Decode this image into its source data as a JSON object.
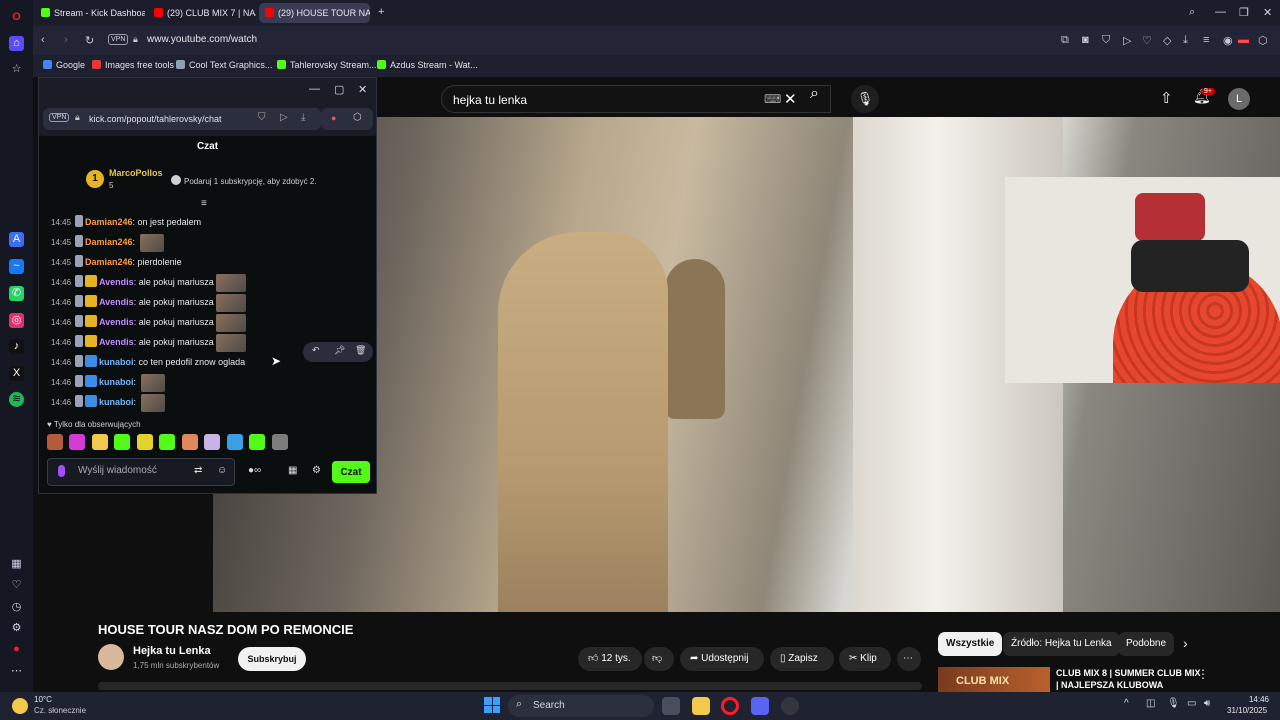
{
  "browser": {
    "tabs": [
      {
        "title": "Stream - Kick Dashboard",
        "color": "#53fc18"
      },
      {
        "title": "(29) CLUB MIX 7 | NAJLEP",
        "color": "#ff0000"
      },
      {
        "title": "(29) HOUSE TOUR NA",
        "color": "#ff0000"
      }
    ],
    "url": "www.youtube.com/watch",
    "vpn": "VPN",
    "bookmarks": [
      {
        "label": "Google",
        "color": "#4285f4"
      },
      {
        "label": "Images free tools",
        "color": "#e53935"
      },
      {
        "label": "Cool Text Graphics...",
        "color": "#8fa1b3"
      },
      {
        "label": "Tahlerovsky Stream...",
        "color": "#53fc18"
      },
      {
        "label": "Azdus Stream - Wat...",
        "color": "#53fc18"
      }
    ]
  },
  "youtube": {
    "search_value": "hejka tu lenka",
    "video_title": "HOUSE TOUR NASZ DOM PO REMONCIE",
    "channel_name": "Hejka tu Lenka",
    "channel_subs": "1,75 mln subskrybentów",
    "subscribe_label": "Subskrybuj",
    "likes": "12 tys.",
    "share_label": "Udostępnij",
    "save_label": "Zapisz",
    "clip_label": "Klip",
    "notif_count": "9+",
    "avatar_letter": "L",
    "chips": [
      "Wszystkie",
      "Źródło: Hejka tu Lenka",
      "Podobne"
    ],
    "rec_title": "CLUB MIX 8 | SUMMER CLUB MIX | NAJLEPSZA KLUBOWA",
    "rec_thumb_text": "CLUB MIX"
  },
  "kick": {
    "url": "kick.com/popout/tahlerovsky/chat",
    "vpn": "VPN",
    "header": "Czat",
    "pinned": {
      "rank": "1",
      "user": "MarcoPollos",
      "level": "5",
      "text": "Podaruj 1 subskrypcję, aby zdobyć 2."
    },
    "messages": [
      {
        "time": "14:45",
        "user": "Damian246",
        "color": "#ff9a3c",
        "text": "on jest pedalem",
        "emote": false,
        "badge": false
      },
      {
        "time": "14:45",
        "user": "Damian246",
        "color": "#ff9a3c",
        "text": "",
        "emote": true,
        "badge": false
      },
      {
        "time": "14:45",
        "user": "Damian246",
        "color": "#ff9a3c",
        "text": "pierdolenie",
        "emote": false,
        "badge": false
      },
      {
        "time": "14:46",
        "user": "Avendis",
        "color": "#c38cff",
        "text": "ale pokuj mariusza",
        "emote": true,
        "badge": true
      },
      {
        "time": "14:46",
        "user": "Avendis",
        "color": "#c38cff",
        "text": "ale pokuj mariusza",
        "emote": true,
        "badge": true
      },
      {
        "time": "14:46",
        "user": "Avendis",
        "color": "#c38cff",
        "text": "ale pokuj mariusza",
        "emote": true,
        "badge": true
      },
      {
        "time": "14:46",
        "user": "Avendis",
        "color": "#c38cff",
        "text": "ale pokuj mariusza",
        "emote": true,
        "badge": true
      },
      {
        "time": "14:46",
        "user": "kunaboi",
        "color": "#6fb8ff",
        "text": "co ten pedofil znow oglada",
        "emote": false,
        "badge": true
      },
      {
        "time": "14:46",
        "user": "kunaboi",
        "color": "#6fb8ff",
        "text": "",
        "emote": true,
        "badge": true
      },
      {
        "time": "14:46",
        "user": "kunaboi",
        "color": "#6fb8ff",
        "text": "",
        "emote": true,
        "badge": true
      }
    ],
    "followers_only": "Tylko dla obserwujących",
    "input_placeholder": "Wyślij wiadomość",
    "send_label": "Czat"
  },
  "taskbar": {
    "temperature": "10°C",
    "weather": "Cz. słonecznie",
    "search_label": "Search",
    "time": "14:46",
    "date": "31/10/2025"
  }
}
